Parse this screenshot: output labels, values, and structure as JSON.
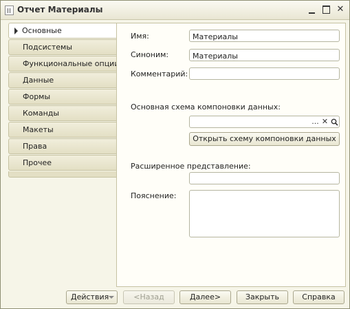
{
  "window": {
    "title": "Отчет Материалы"
  },
  "tabs": [
    {
      "label": "Основные"
    },
    {
      "label": "Подсистемы"
    },
    {
      "label": "Функциональные опции"
    },
    {
      "label": "Данные"
    },
    {
      "label": "Формы"
    },
    {
      "label": "Команды"
    },
    {
      "label": "Макеты"
    },
    {
      "label": "Права"
    },
    {
      "label": "Прочее"
    }
  ],
  "form": {
    "name_label": "Имя:",
    "name_value": "Материалы",
    "synonym_label": "Синоним:",
    "synonym_value": "Материалы",
    "comment_label": "Комментарий:",
    "comment_value": "",
    "schema_label": "Основная схема компоновки данных:",
    "schema_value": "",
    "schema_ellipsis": "...",
    "schema_clear": "✕",
    "open_schema_button": "Открыть схему компоновки данных",
    "extended_label": "Расширенное представление:",
    "extended_value": "",
    "explanation_label": "Пояснение:",
    "explanation_value": ""
  },
  "footer": {
    "actions": "Действия",
    "back": "<Назад",
    "next": "Далее>",
    "close": "Закрыть",
    "help": "Справка"
  }
}
